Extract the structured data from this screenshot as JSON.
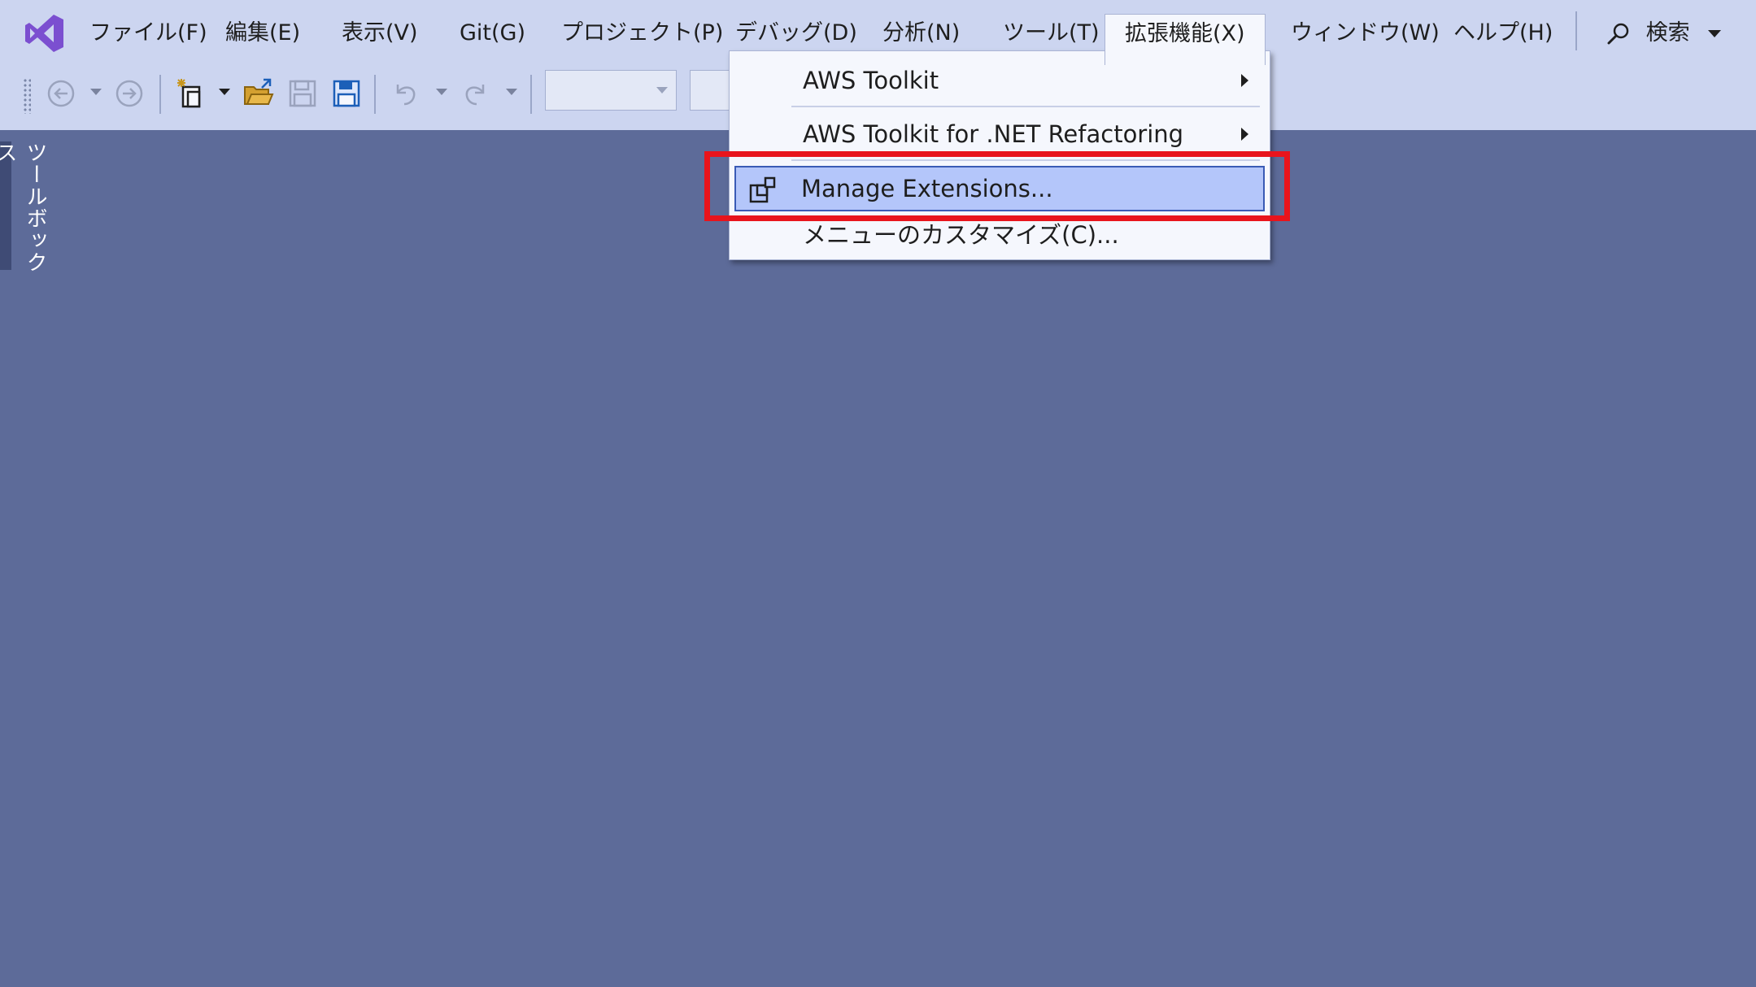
{
  "menubar": {
    "items": [
      {
        "label": "ファイル(F)"
      },
      {
        "label": "編集(E)"
      },
      {
        "label": "表示(V)"
      },
      {
        "label": "Git(G)"
      },
      {
        "label": "プロジェクト(P)"
      },
      {
        "label": "デバッグ(D)"
      },
      {
        "label": "分析(N)"
      },
      {
        "label": "ツール(T)"
      },
      {
        "label": "拡張機能(X)"
      },
      {
        "label": "ウィンドウ(W)"
      },
      {
        "label": "ヘルプ(H)"
      }
    ],
    "search_label": "検索",
    "open_menu": "拡張機能(X)"
  },
  "toolbox": {
    "label": "ツールボックス"
  },
  "dropdown": {
    "items": [
      {
        "label": "AWS Toolkit",
        "submenu": true
      },
      {
        "label": "AWS Toolkit for .NET Refactoring",
        "submenu": true
      },
      {
        "label": "Manage Extensions...",
        "highlighted": true,
        "icon": "manage-extensions-icon"
      },
      {
        "label": "メニューのカスタマイズ(C)..."
      }
    ]
  },
  "colors": {
    "workspace": "#5d6b99",
    "chrome": "#ccd5f0",
    "menu_bg": "#f5f7fd",
    "hover": "#b4c6fa",
    "annotation": "#e8141c",
    "vs_purple": "#7b4fd0"
  }
}
